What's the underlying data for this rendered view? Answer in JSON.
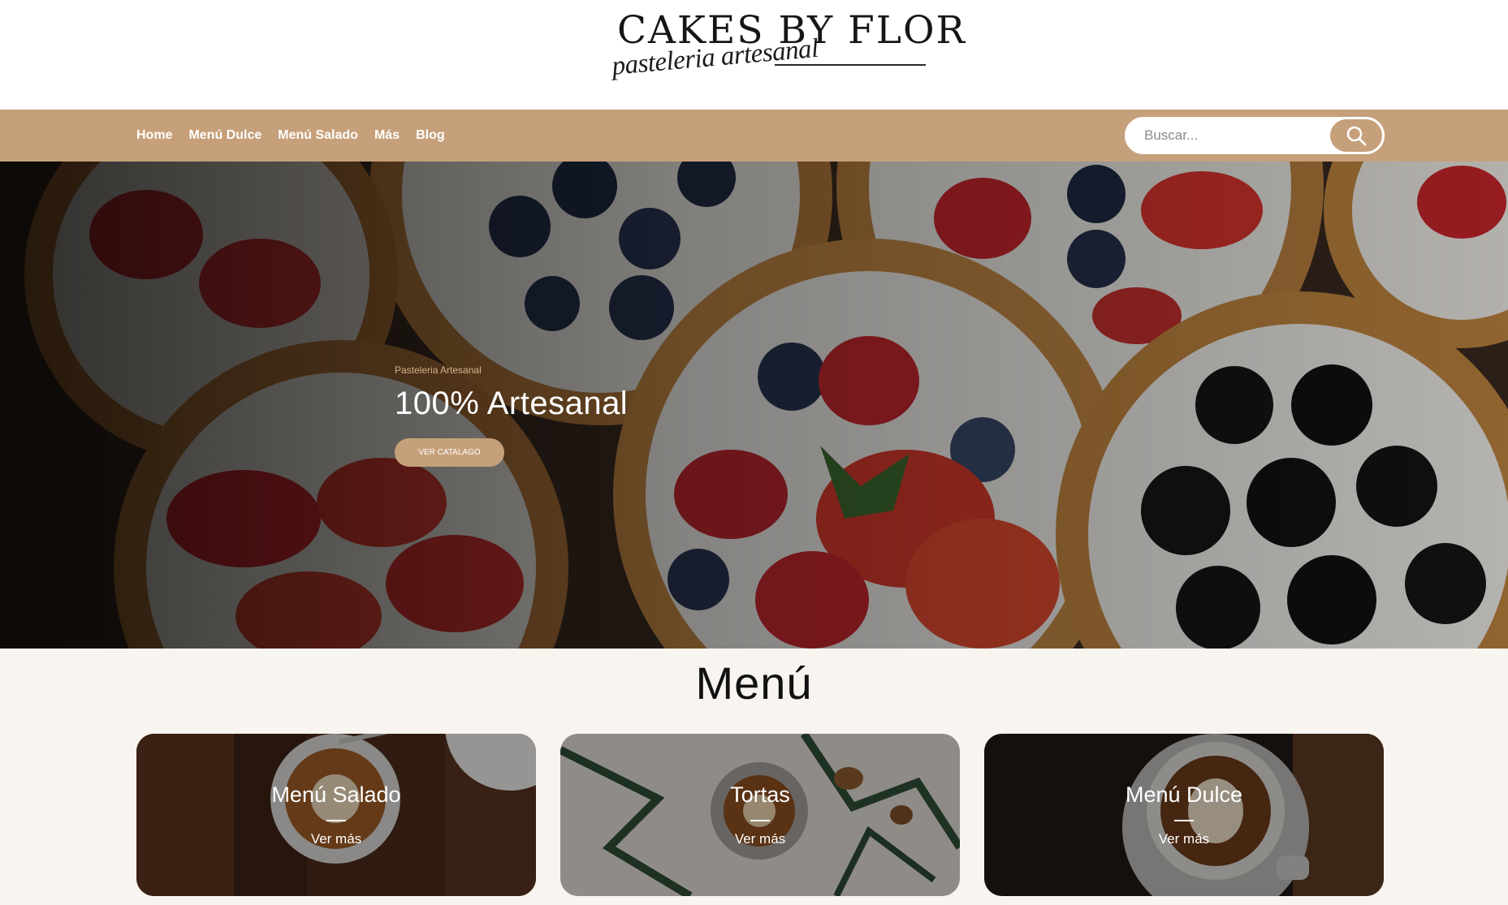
{
  "brand": {
    "name": "CAKES BY FLOR",
    "tagline": "pasteleria artesanal"
  },
  "nav": {
    "items": [
      {
        "label": "Home"
      },
      {
        "label": "Menú Dulce"
      },
      {
        "label": "Menú Salado"
      },
      {
        "label": "Más"
      },
      {
        "label": "Blog"
      }
    ]
  },
  "search": {
    "placeholder": "Buscar...",
    "icon": "search-icon"
  },
  "hero": {
    "eyebrow": "Pasteleria Artesanal",
    "title": "100% Artesanal",
    "button_label": "VER CATALAGO"
  },
  "menu": {
    "title": "Menú",
    "cards": [
      {
        "title": "Menú Salado",
        "link": "Ver más"
      },
      {
        "title": "Tortas",
        "link": "Ver más"
      },
      {
        "title": "Menú Dulce",
        "link": "Ver más"
      }
    ]
  },
  "colors": {
    "accent": "#c6a07a",
    "section_bg": "#f8f4ef"
  }
}
